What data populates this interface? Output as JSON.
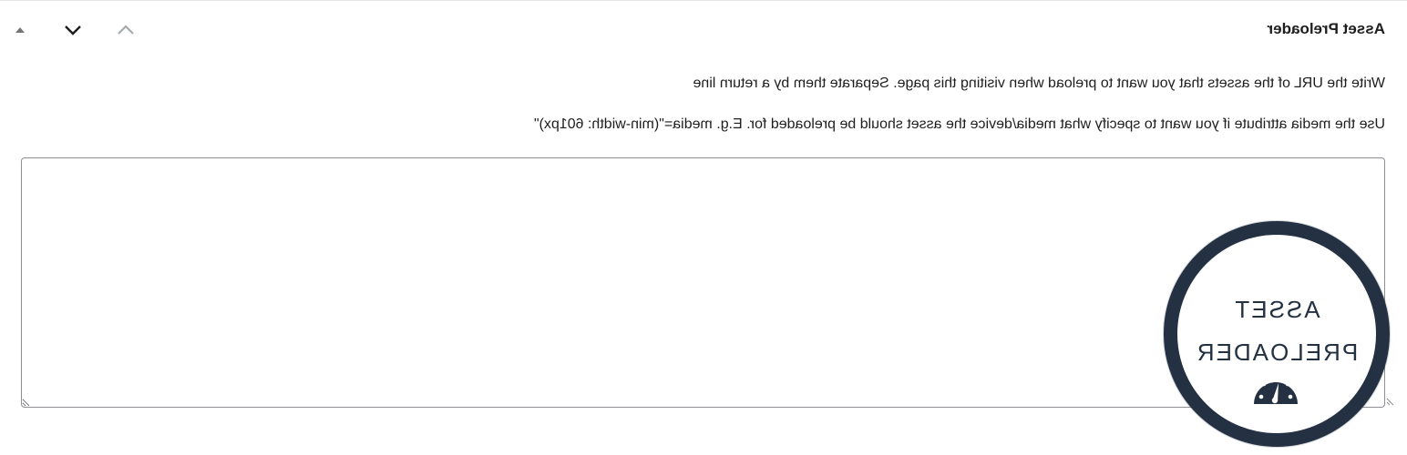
{
  "panel": {
    "title": "Asset Preloader",
    "controls": {
      "move_up": "move-up",
      "move_down": "move-down",
      "toggle": "toggle-panel"
    }
  },
  "description": {
    "line1": "Write the URL of the assets that you want to preload when visiting this page. Separate them by a return line",
    "line2": "Use the media attribute if you want to specify what media/device the asset should be preloaded for. E.g. media=\"(min-width: 601px)\""
  },
  "textarea": {
    "value": "",
    "placeholder": ""
  },
  "badge": {
    "line1": "ASSET",
    "line2": "PRELOADER"
  },
  "colors": {
    "badge_ring": "#243142",
    "text": "#1e1e1e",
    "border": "#8c8f94"
  },
  "icons": [
    "chevron-up-icon",
    "chevron-down-icon",
    "triangle-up-icon",
    "gauge-icon",
    "resize-grip-icon"
  ]
}
